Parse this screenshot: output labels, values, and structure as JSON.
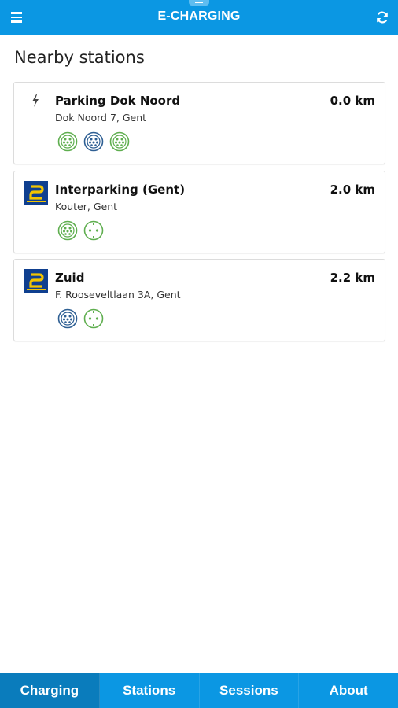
{
  "header": {
    "title": "E-CHARGING",
    "menu_icon": "hamburger-menu-icon",
    "refresh_icon": "refresh-icon",
    "color": "#0b97e3"
  },
  "page": {
    "heading": "Nearby stations"
  },
  "stations": [
    {
      "name": "Parking Dok Noord",
      "address": "Dok Noord 7, Gent",
      "distance": "0.0 km",
      "logo": "lightning-bolt-icon",
      "connectors": [
        "type2-connector-green",
        "type2-connector-blue",
        "type2-connector-green"
      ]
    },
    {
      "name": "Interparking (Gent)",
      "address": "Kouter, Gent",
      "distance": "2.0 km",
      "logo": "interparking-logo",
      "connectors": [
        "type2-connector-green",
        "schuko-connector-green"
      ]
    },
    {
      "name": "Zuid",
      "address": "F. Rooseveltlaan 3A, Gent",
      "distance": "2.2 km",
      "logo": "interparking-logo",
      "connectors": [
        "type2-connector-blue",
        "schuko-connector-green"
      ]
    }
  ],
  "tabs": [
    {
      "label": "Charging",
      "active": true
    },
    {
      "label": "Stations",
      "active": false
    },
    {
      "label": "Sessions",
      "active": false
    },
    {
      "label": "About",
      "active": false
    }
  ],
  "colors": {
    "connector_green": "#5fae4f",
    "connector_blue": "#2e5f93",
    "logo_blue": "#0f3f8f",
    "logo_yellow": "#f2c400"
  }
}
